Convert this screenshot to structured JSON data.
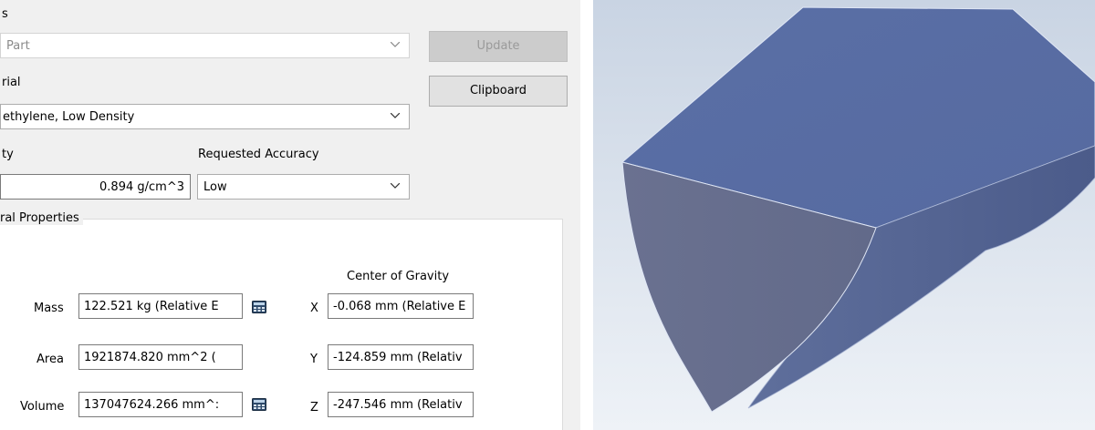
{
  "header": {
    "partial_label": "s"
  },
  "part_combo": {
    "value": "Part"
  },
  "update_button": {
    "label": "Update"
  },
  "clipboard_button": {
    "label": "Clipboard"
  },
  "material": {
    "label": "rial",
    "value": "ethylene, Low Density"
  },
  "density": {
    "label": "ty",
    "value": "0.894 g/cm^3"
  },
  "accuracy": {
    "label": "Requested Accuracy",
    "value": "Low"
  },
  "general_properties": {
    "title": "ral Properties",
    "center_of_gravity_label": "Center of Gravity",
    "mass": {
      "label": "Mass",
      "value": "122.521 kg (Relative E"
    },
    "area": {
      "label": "Area",
      "value": "1921874.820 mm^2 ("
    },
    "volume": {
      "label": "Volume",
      "value": "137047624.266 mm^:"
    },
    "x": {
      "label": "X",
      "value": "-0.068 mm (Relative E"
    },
    "y": {
      "label": "Y",
      "value": "-124.859 mm (Relativ"
    },
    "z": {
      "label": "Z",
      "value": "-247.546 mm (Relativ"
    }
  },
  "icons": [
    "chevron-down-icon",
    "calculator-icon"
  ],
  "colors": {
    "dialog_bg": "#f0f0f0",
    "viewport_bg": "#dde6f0",
    "model_face": "#5b6fa3",
    "model_side": "#646c8a"
  }
}
